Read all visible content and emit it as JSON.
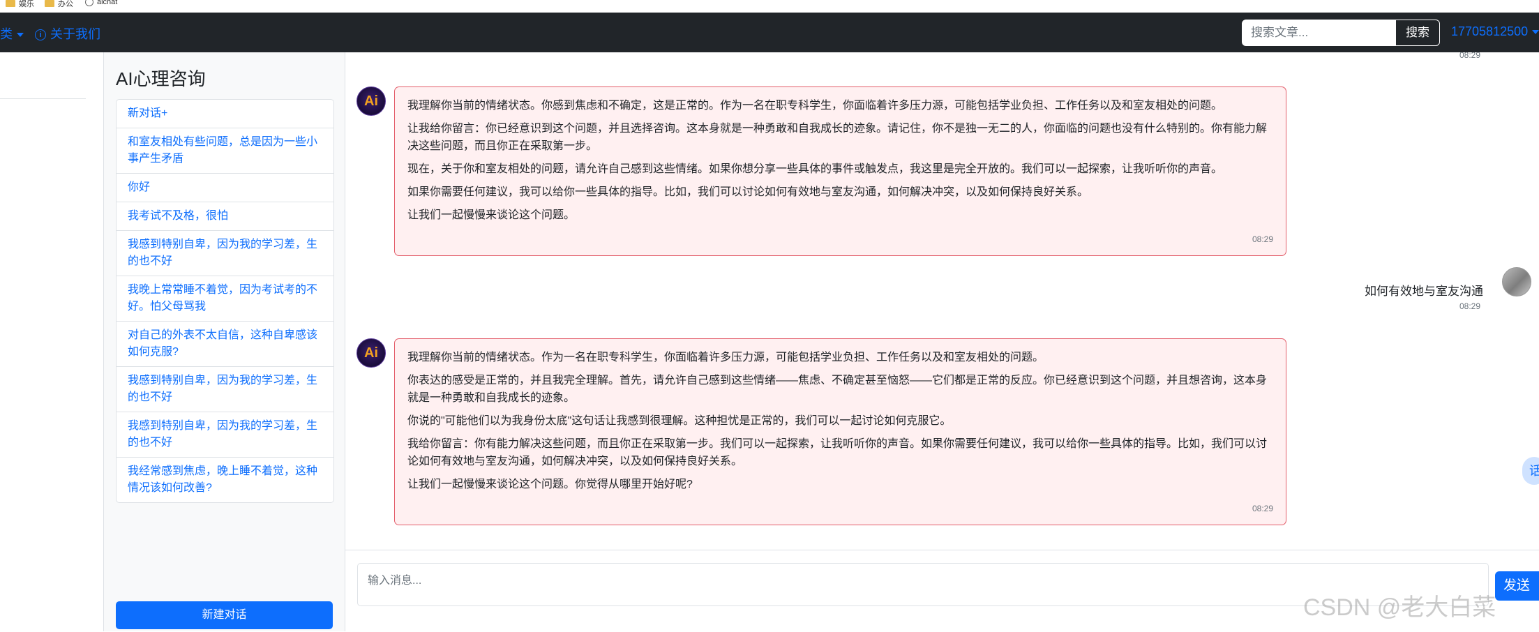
{
  "bookmarks": [
    {
      "label": "娱乐",
      "icon": "folder-icon"
    },
    {
      "label": "办公",
      "icon": "folder-icon"
    },
    {
      "label": "aichat",
      "icon": "globe-icon"
    }
  ],
  "navbar": {
    "category_label": "类",
    "about_label": "关于我们",
    "search_placeholder": "搜索文章...",
    "search_button": "搜索",
    "user_label": "17705812500"
  },
  "sidebar": {
    "title": "AI心理咨询",
    "items": [
      "新对话+",
      "和室友相处有些问题，总是因为一些小事产生矛盾",
      "你好",
      "我考试不及格，很怕",
      "我感到特别自卑，因为我的学习差，生的也不好",
      "我晚上常常睡不着觉，因为考试考的不好。怕父母骂我",
      "对自己的外表不太自信，这种自卑感该如何克服?",
      "我感到特别自卑，因为我的学习差，生的也不好",
      "我感到特别自卑，因为我的学习差，生的也不好",
      "我经常感到焦虑，晚上睡不着觉，这种情况该如何改善?"
    ],
    "new_button": "新建对话"
  },
  "chat": {
    "top_timestamp": "08:29",
    "avatar_text": "Ai",
    "messages": [
      {
        "role": "ai",
        "paragraphs": [
          "我理解你当前的情绪状态。你感到焦虑和不确定，这是正常的。作为一名在职专科学生，你面临着许多压力源，可能包括学业负担、工作任务以及和室友相处的问题。",
          "让我给你留言：你已经意识到这个问题，并且选择咨询。这本身就是一种勇敢和自我成长的迹象。请记住，你不是独一无二的人，你面临的问题也没有什么特别的。你有能力解决这些问题，而且你正在采取第一步。",
          "现在，关于你和室友相处的问题，请允许自己感到这些情绪。如果你想分享一些具体的事件或触发点，我这里是完全开放的。我们可以一起探索，让我听听你的声音。",
          "如果你需要任何建议，我可以给你一些具体的指导。比如，我们可以讨论如何有效地与室友沟通，如何解决冲突，以及如何保持良好关系。",
          "让我们一起慢慢来谈论这个问题。"
        ],
        "time": "08:29"
      },
      {
        "role": "user",
        "text": "如何有效地与室友沟通",
        "time": "08:29"
      },
      {
        "role": "ai",
        "paragraphs": [
          "我理解你当前的情绪状态。作为一名在职专科学生，你面临着许多压力源，可能包括学业负担、工作任务以及和室友相处的问题。",
          "你表达的感受是正常的，并且我完全理解。首先，请允许自己感到这些情绪——焦虑、不确定甚至恼怒——它们都是正常的反应。你已经意识到这个问题，并且想咨询，这本身就是一种勇敢和自我成长的迹象。",
          "你说的\"可能他们以为我身份太底\"这句话让我感到很理解。这种担忧是正常的，我们可以一起讨论如何克服它。",
          "我给你留言：你有能力解决这些问题，而且你正在采取第一步。我们可以一起探索，让我听听你的声音。如果你需要任何建议，我可以给你一些具体的指导。比如，我们可以讨论如何有效地与室友沟通，如何解决冲突，以及如何保持良好关系。",
          "让我们一起慢慢来谈论这个问题。你觉得从哪里开始好呢?"
        ],
        "time": "08:29"
      }
    ],
    "float_button": "话"
  },
  "composer": {
    "placeholder": "输入消息...",
    "send_button": "发送"
  },
  "watermark": "CSDN @老大白菜"
}
